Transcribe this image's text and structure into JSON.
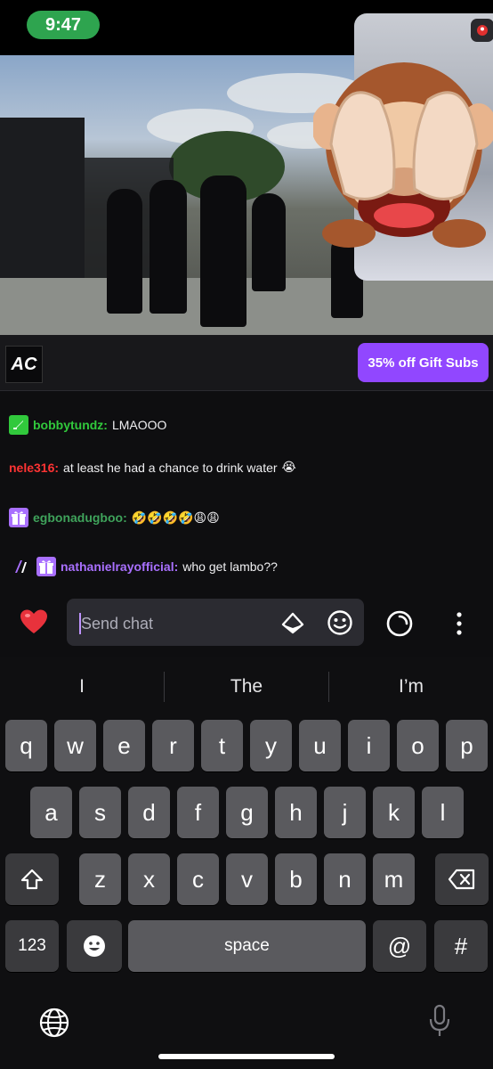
{
  "status_bar": {
    "time": "9:47"
  },
  "channel": {
    "logo_text": "AC",
    "gift_subs_label": "35% off Gift Subs"
  },
  "chat": {
    "messages": [
      {
        "username": "bobbytundz:",
        "text": "LMAOOO",
        "user_color": "#31c93c",
        "emoji": ""
      },
      {
        "username": "nele316:",
        "text": "at least he had a chance to drink water",
        "user_color": "#ff3333",
        "emoji": "😭"
      },
      {
        "username": "egbonadugboo:",
        "text": "",
        "user_color": "#3fa35b",
        "emoji": "🤣🤣🤣🤣😩😩"
      },
      {
        "username": "nathanielrayofficial:",
        "text": "who get lambo??",
        "user_color": "#a970ff",
        "emoji": ""
      }
    ],
    "input_placeholder": "Send chat"
  },
  "keyboard": {
    "suggestions": [
      "I",
      "The",
      "I’m"
    ],
    "row1": [
      "q",
      "w",
      "e",
      "r",
      "t",
      "y",
      "u",
      "i",
      "o",
      "p"
    ],
    "row2": [
      "a",
      "s",
      "d",
      "f",
      "g",
      "h",
      "j",
      "k",
      "l"
    ],
    "row3": [
      "z",
      "x",
      "c",
      "v",
      "b",
      "n",
      "m"
    ],
    "numbers_label": "123",
    "space_label": "space",
    "at_label": "@",
    "hash_label": "#"
  },
  "colors": {
    "accent": "#9147ff",
    "time_pill": "#2ea44f"
  },
  "icons": [
    "heart-icon",
    "diamond-icon",
    "emoji-icon",
    "channel-points-icon",
    "more-icon",
    "shift-icon",
    "backspace-icon",
    "emoji-keyboard-icon",
    "globe-icon",
    "microphone-icon"
  ]
}
